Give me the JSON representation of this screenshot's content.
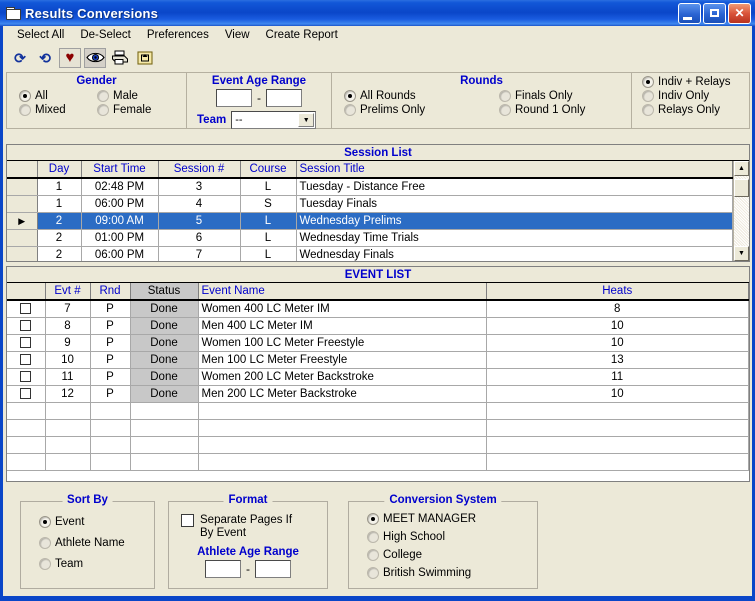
{
  "window": {
    "title": "Results Conversions",
    "icon": "folder-icon",
    "buttons": {
      "minimize": "minimize-icon",
      "maximize": "maximize-icon",
      "close": "close-icon"
    }
  },
  "menu": {
    "items": [
      {
        "label": "Select All"
      },
      {
        "label": "De-Select"
      },
      {
        "label": "Preferences"
      },
      {
        "label": "View"
      },
      {
        "label": "Create Report"
      }
    ]
  },
  "toolbar": {
    "items": [
      {
        "name": "redo-icon",
        "glyph": "↷"
      },
      {
        "name": "undo-icon",
        "glyph": "↶"
      },
      {
        "name": "heart-icon",
        "glyph": "♥"
      },
      {
        "name": "eye-icon",
        "glyph": ""
      },
      {
        "name": "printer-icon",
        "glyph": ""
      },
      {
        "name": "export-icon",
        "glyph": ""
      }
    ]
  },
  "filters": {
    "gender": {
      "title": "Gender",
      "options": [
        {
          "label": "All",
          "selected": true
        },
        {
          "label": "Male",
          "selected": false
        },
        {
          "label": "Mixed",
          "selected": false
        },
        {
          "label": "Female",
          "selected": false
        }
      ]
    },
    "event_age_range": {
      "title": "Event Age Range",
      "from": "",
      "to": "",
      "separator": "-",
      "team_label": "Team",
      "team_value": "--"
    },
    "rounds": {
      "title": "Rounds",
      "options": [
        {
          "label": "All Rounds",
          "selected": true
        },
        {
          "label": "Finals Only",
          "selected": false
        },
        {
          "label": "Prelims Only",
          "selected": false
        },
        {
          "label": "Round 1 Only",
          "selected": false
        }
      ]
    },
    "entry_type": {
      "options": [
        {
          "label": "Indiv + Relays",
          "selected": true
        },
        {
          "label": "Indiv Only",
          "selected": false
        },
        {
          "label": "Relays Only",
          "selected": false
        }
      ]
    }
  },
  "session_list": {
    "caption": "Session List",
    "columns": [
      "",
      "Day",
      "Start Time",
      "Session #",
      "Course",
      "Session Title"
    ],
    "rows": [
      {
        "marker": "",
        "day": "1",
        "start_time": "02:48 PM",
        "session": "3",
        "course": "L",
        "title": "Tuesday - Distance Free",
        "selected": false
      },
      {
        "marker": "",
        "day": "1",
        "start_time": "06:00 PM",
        "session": "4",
        "course": "S",
        "title": "Tuesday Finals",
        "selected": false
      },
      {
        "marker": "▶",
        "day": "2",
        "start_time": "09:00 AM",
        "session": "5",
        "course": "L",
        "title": "Wednesday Prelims",
        "selected": true
      },
      {
        "marker": "",
        "day": "2",
        "start_time": "01:00 PM",
        "session": "6",
        "course": "L",
        "title": "Wednesday Time Trials",
        "selected": false
      },
      {
        "marker": "",
        "day": "2",
        "start_time": "06:00 PM",
        "session": "7",
        "course": "L",
        "title": "Wednesday Finals",
        "selected": false
      }
    ],
    "scrollbar": {
      "up": "▲",
      "down": "▼"
    }
  },
  "event_list": {
    "caption": "EVENT LIST",
    "columns": [
      "",
      "Evt #",
      "Rnd",
      "Status",
      "Event Name",
      "Heats"
    ],
    "rows": [
      {
        "checked": false,
        "evt": "7",
        "rnd": "P",
        "status": "Done",
        "name": "Women 400 LC Meter IM",
        "heats": "8"
      },
      {
        "checked": false,
        "evt": "8",
        "rnd": "P",
        "status": "Done",
        "name": "Men 400 LC Meter IM",
        "heats": "10"
      },
      {
        "checked": false,
        "evt": "9",
        "rnd": "P",
        "status": "Done",
        "name": "Women 100 LC Meter Freestyle",
        "heats": "10"
      },
      {
        "checked": false,
        "evt": "10",
        "rnd": "P",
        "status": "Done",
        "name": "Men 100 LC Meter Freestyle",
        "heats": "13"
      },
      {
        "checked": false,
        "evt": "11",
        "rnd": "P",
        "status": "Done",
        "name": "Women 200 LC Meter Backstroke",
        "heats": "11"
      },
      {
        "checked": false,
        "evt": "12",
        "rnd": "P",
        "status": "Done",
        "name": "Men 200 LC Meter Backstroke",
        "heats": "10"
      }
    ],
    "empty_row_count": 4
  },
  "sort_by": {
    "title": "Sort By",
    "options": [
      {
        "label": "Event",
        "selected": true
      },
      {
        "label": "Athlete Name",
        "selected": false
      },
      {
        "label": "Team",
        "selected": false
      }
    ]
  },
  "format": {
    "title": "Format",
    "separate_pages_label": "Separate Pages If By Event",
    "separate_pages_checked": false,
    "athlete_age_range_label": "Athlete Age Range",
    "age_from": "",
    "age_to": "",
    "separator": "-"
  },
  "conversion_system": {
    "title": "Conversion System",
    "options": [
      {
        "label": "MEET MANAGER",
        "selected": true
      },
      {
        "label": "High School",
        "selected": false
      },
      {
        "label": "College",
        "selected": false
      },
      {
        "label": "British Swimming",
        "selected": false
      }
    ]
  },
  "colors": {
    "window_frame": "#0a46c8",
    "client_background": "#ece9d8",
    "group_title": "#0000cc",
    "selection": "#2b6cc4",
    "status_cell": "#c8c8c8"
  }
}
